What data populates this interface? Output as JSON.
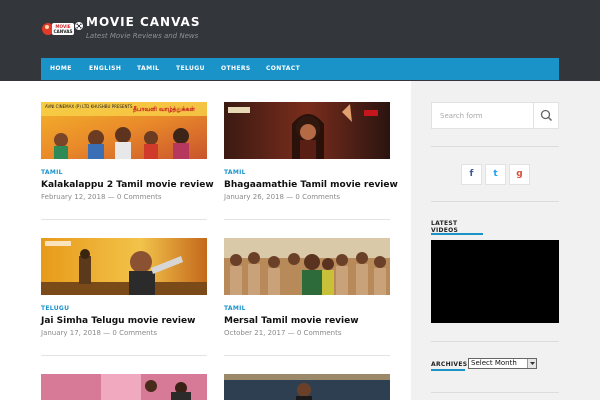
{
  "site": {
    "title": "MOVIE CANVAS",
    "tagline": "Latest Movie Reviews and News",
    "logo_text": "MOVIE CANVAS"
  },
  "nav": {
    "items": [
      {
        "label": "HOME"
      },
      {
        "label": "ENGLISH"
      },
      {
        "label": "TAMIL"
      },
      {
        "label": "TELUGU"
      },
      {
        "label": "OTHERS"
      },
      {
        "label": "CONTACT"
      }
    ]
  },
  "posts": [
    {
      "category": "TAMIL",
      "title": "Kalakalappu 2 Tamil movie review",
      "date": "February 12, 2018",
      "comments": "0 Comments",
      "image_text": "AVNI CINEMAX (P) LTD KHUSHBU PRESENTS"
    },
    {
      "category": "TAMIL",
      "title": "Bhagaamathie Tamil movie review",
      "date": "January 26, 2018",
      "comments": "0 Comments",
      "image_text": ""
    },
    {
      "category": "TELUGU",
      "title": "Jai Simha Telugu movie review",
      "date": "January 17, 2018",
      "comments": "0 Comments",
      "image_text": ""
    },
    {
      "category": "TAMIL",
      "title": "Mersal Tamil movie review",
      "date": "October 21, 2017",
      "comments": "0 Comments",
      "image_text": ""
    }
  ],
  "sidebar": {
    "search": {
      "placeholder": "Search form"
    },
    "social": [
      {
        "icon": "facebook-icon",
        "glyph": "f",
        "color": "#3b5998"
      },
      {
        "icon": "twitter-icon",
        "glyph": "t",
        "color": "#1da1f2"
      },
      {
        "icon": "google-plus-icon",
        "glyph": "g",
        "color": "#dd4b39"
      }
    ],
    "latest_videos_title_line1": "LATEST",
    "latest_videos_title_line2": "VIDEOS",
    "archives_title": "ARCHIVES",
    "archives_select": "Select Month"
  },
  "colors": {
    "header": "#33363b",
    "nav": "#1a93c9",
    "accent": "#1a93c9",
    "sidebar": "#f1f1f1"
  }
}
